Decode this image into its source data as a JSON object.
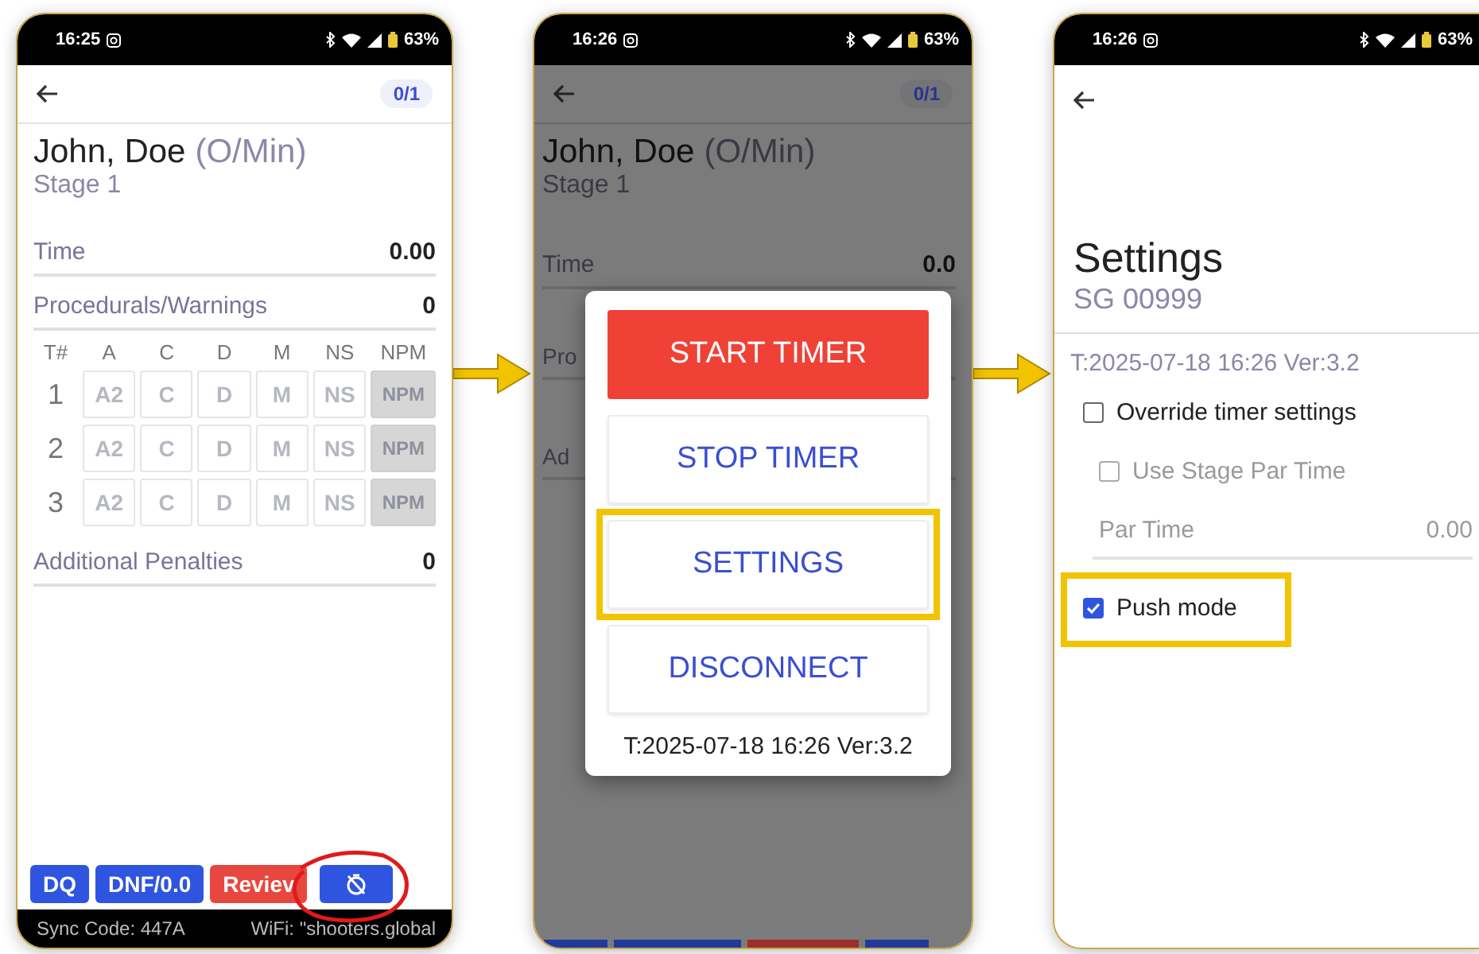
{
  "panels": [
    {
      "kind": "scoring",
      "status_bar": {
        "time": "16:25",
        "battery": "63%"
      },
      "counter": "0/1",
      "competitor": "John, Doe",
      "division": "(O/Min)",
      "stage": "Stage 1",
      "rows": [
        {
          "label": "Time",
          "value": "0.00"
        },
        {
          "label": "Procedurals/Warnings",
          "value": "0"
        }
      ],
      "table": {
        "columns": [
          "T#",
          "A",
          "C",
          "D",
          "M",
          "NS",
          "NPM"
        ],
        "rows": [
          {
            "cells": [
              {
                "kind": "number",
                "text": "1"
              },
              {
                "text": "A2",
                "disabled": false
              },
              {
                "text": "C",
                "disabled": false
              },
              {
                "text": "D",
                "disabled": false
              },
              {
                "text": "M",
                "disabled": false
              },
              {
                "text": "NS",
                "disabled": false
              },
              {
                "text": "NPM",
                "disabled": true
              }
            ]
          },
          {
            "cells": [
              {
                "kind": "number",
                "text": "2"
              },
              {
                "text": "A2",
                "disabled": false
              },
              {
                "text": "C",
                "disabled": false
              },
              {
                "text": "D",
                "disabled": false
              },
              {
                "text": "M",
                "disabled": false
              },
              {
                "text": "NS",
                "disabled": false
              },
              {
                "text": "NPM",
                "disabled": true
              }
            ]
          },
          {
            "cells": [
              {
                "kind": "number",
                "text": "3"
              },
              {
                "text": "A2",
                "disabled": false
              },
              {
                "text": "C",
                "disabled": false
              },
              {
                "text": "D",
                "disabled": false
              },
              {
                "text": "M",
                "disabled": false
              },
              {
                "text": "NS",
                "disabled": false
              },
              {
                "text": "NPM",
                "disabled": true
              }
            ]
          }
        ]
      },
      "additional": {
        "label": "Additional Penalties",
        "value": "0"
      },
      "buttons": [
        {
          "kind": "primary",
          "label": "DQ"
        },
        {
          "kind": "primary",
          "label": "DNF/0.0"
        },
        {
          "kind": "danger",
          "label": "Reviev"
        },
        {
          "kind": "timer",
          "circled": true
        }
      ],
      "footer": {
        "sync": "Sync Code: 447A",
        "wifi": "WiFi: \"shooters.global"
      }
    },
    {
      "kind": "timer_menu",
      "status_bar": {
        "time": "16:26",
        "battery": "63%"
      },
      "counter": "0/1",
      "competitor": "John, Doe",
      "division": "(O/Min)",
      "stage": "Stage 1",
      "rows": [
        {
          "label": "Time",
          "value": "0.0"
        },
        {
          "label": "Pro"
        },
        {
          "label": "Ad"
        }
      ],
      "dialog": {
        "buttons": [
          {
            "kind": "filled",
            "label": "START TIMER"
          },
          {
            "kind": "outlined",
            "label": "STOP TIMER"
          },
          {
            "kind": "outlined",
            "label": "SETTINGS",
            "boxed": true
          },
          {
            "kind": "outlined",
            "label": "DISCONNECT"
          }
        ],
        "footer": "T:2025-07-18 16:26 Ver:3.2"
      }
    },
    {
      "kind": "settings",
      "status_bar": {
        "time": "16:26",
        "battery": "63%"
      },
      "title": "Settings",
      "subtitle": "SG 00999",
      "info": "T:2025-07-18 16:26 Ver:3.2",
      "options": [
        {
          "kind": "checkbox",
          "label": "Override timer settings",
          "checked": false,
          "disabled": false,
          "children": [
            {
              "kind": "checkbox",
              "label": "Use Stage Par Time",
              "checked": false,
              "disabled": true
            },
            {
              "kind": "field",
              "label": "Par Time",
              "value": "0.00",
              "disabled": true
            }
          ]
        },
        {
          "kind": "checkbox",
          "label": "Push mode",
          "checked": true,
          "disabled": false,
          "boxed": true
        }
      ]
    }
  ]
}
